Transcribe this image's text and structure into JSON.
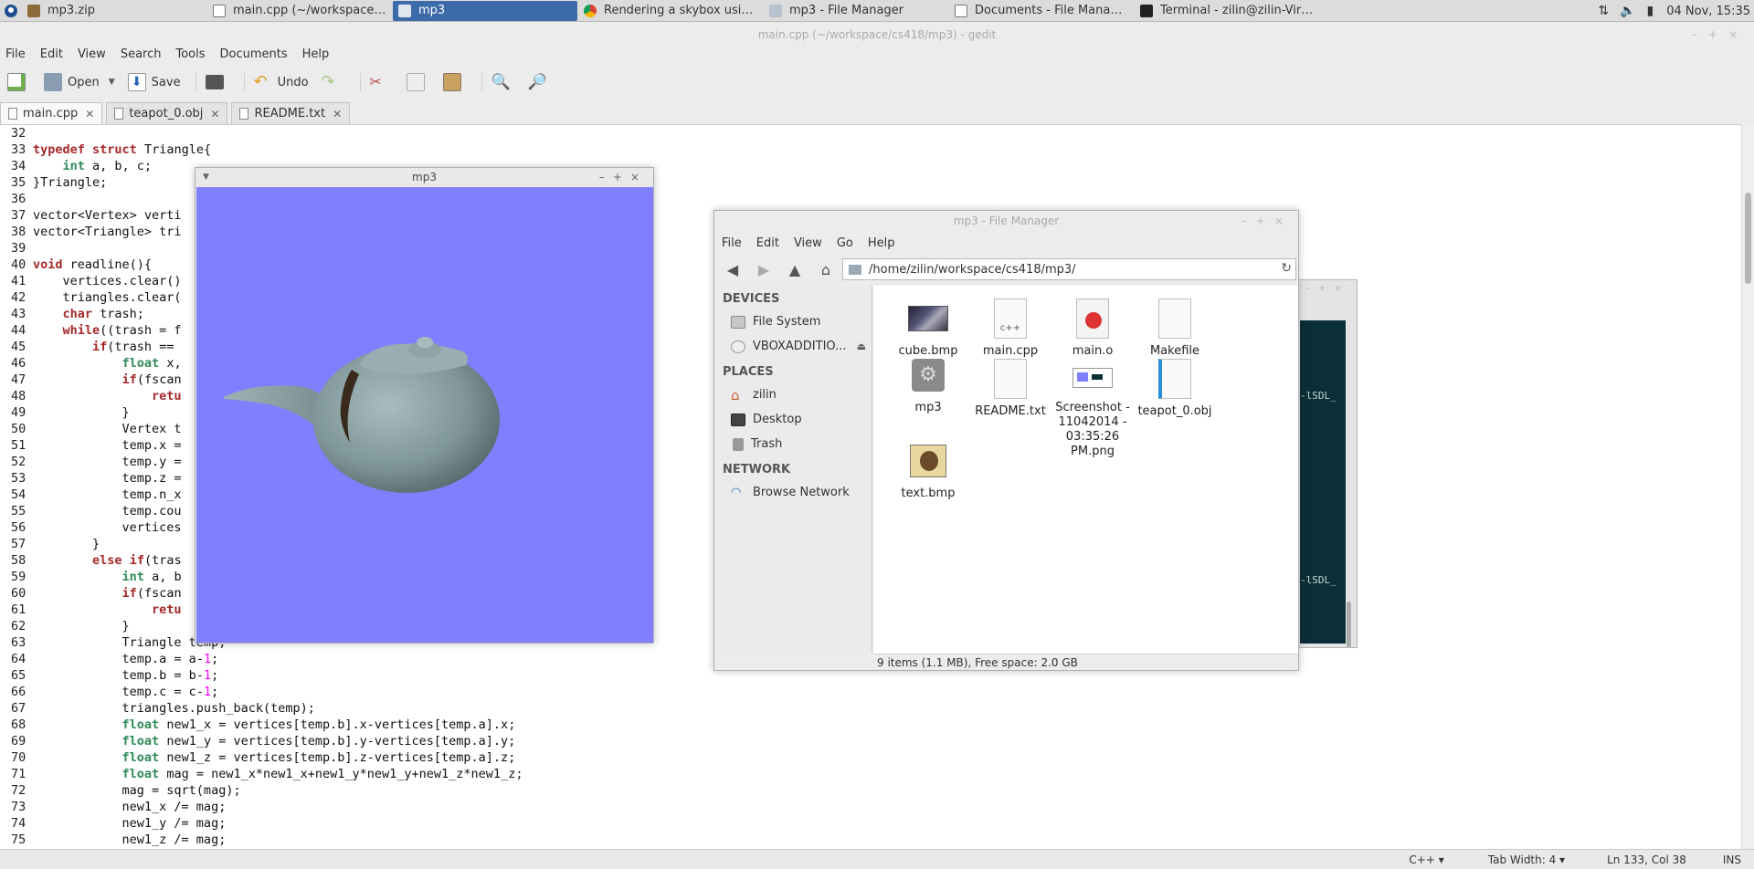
{
  "taskbar": {
    "tasks": [
      {
        "label": "mp3.zip"
      },
      {
        "label": "main.cpp (~/workspace/cs..."
      },
      {
        "label": "mp3"
      },
      {
        "label": "Rendering a skybox using ..."
      },
      {
        "label": "mp3 - File Manager"
      },
      {
        "label": "Documents - File Manager"
      },
      {
        "label": "Terminal - zilin@zilin-Virtua..."
      }
    ],
    "clock": "04 Nov, 15:35"
  },
  "gedit": {
    "title": "main.cpp (~/workspace/cs418/mp3) - gedit",
    "menu": [
      "File",
      "Edit",
      "View",
      "Search",
      "Tools",
      "Documents",
      "Help"
    ],
    "toolbar": {
      "open": "Open",
      "save": "Save",
      "undo": "Undo"
    },
    "tabs": [
      {
        "label": "main.cpp"
      },
      {
        "label": "teapot_0.obj"
      },
      {
        "label": "README.txt"
      }
    ],
    "status": {
      "lang": "C++",
      "tab_width": "Tab Width: 4",
      "position": "Ln 133, Col 38",
      "mode": "INS"
    }
  },
  "code_lines": [
    {
      "n": "32",
      "t": ""
    },
    {
      "n": "33",
      "t": "typedef struct Triangle{"
    },
    {
      "n": "34",
      "t": "    int a, b, c;"
    },
    {
      "n": "35",
      "t": "}Triangle;"
    },
    {
      "n": "36",
      "t": ""
    },
    {
      "n": "37",
      "t": "vector<Vertex> verti"
    },
    {
      "n": "38",
      "t": "vector<Triangle> tri"
    },
    {
      "n": "39",
      "t": ""
    },
    {
      "n": "40",
      "t": "void readline(){"
    },
    {
      "n": "41",
      "t": "    vertices.clear()"
    },
    {
      "n": "42",
      "t": "    triangles.clear("
    },
    {
      "n": "43",
      "t": "    char trash;"
    },
    {
      "n": "44",
      "t": "    while((trash = f"
    },
    {
      "n": "45",
      "t": "        if(trash =="
    },
    {
      "n": "46",
      "t": "            float x,"
    },
    {
      "n": "47",
      "t": "            if(fscan"
    },
    {
      "n": "48",
      "t": "                retu"
    },
    {
      "n": "49",
      "t": "            }"
    },
    {
      "n": "50",
      "t": "            Vertex t"
    },
    {
      "n": "51",
      "t": "            temp.x ="
    },
    {
      "n": "52",
      "t": "            temp.y ="
    },
    {
      "n": "53",
      "t": "            temp.z ="
    },
    {
      "n": "54",
      "t": "            temp.n_x"
    },
    {
      "n": "55",
      "t": "            temp.cou"
    },
    {
      "n": "56",
      "t": "            vertices"
    },
    {
      "n": "57",
      "t": "        }"
    },
    {
      "n": "58",
      "t": "        else if(tras"
    },
    {
      "n": "59",
      "t": "            int a, b"
    },
    {
      "n": "60",
      "t": "            if(fscan"
    },
    {
      "n": "61",
      "t": "                retu"
    },
    {
      "n": "62",
      "t": "            }"
    },
    {
      "n": "63",
      "t": "            Triangle temp;"
    },
    {
      "n": "64",
      "t": "            temp.a = a-1;"
    },
    {
      "n": "65",
      "t": "            temp.b = b-1;"
    },
    {
      "n": "66",
      "t": "            temp.c = c-1;"
    },
    {
      "n": "67",
      "t": "            triangles.push_back(temp);"
    },
    {
      "n": "68",
      "t": "            float new1_x = vertices[temp.b].x-vertices[temp.a].x;"
    },
    {
      "n": "69",
      "t": "            float new1_y = vertices[temp.b].y-vertices[temp.a].y;"
    },
    {
      "n": "70",
      "t": "            float new1_z = vertices[temp.b].z-vertices[temp.a].z;"
    },
    {
      "n": "71",
      "t": "            float mag = new1_x*new1_x+new1_y*new1_y+new1_z*new1_z;"
    },
    {
      "n": "72",
      "t": "            mag = sqrt(mag);"
    },
    {
      "n": "73",
      "t": "            new1_x /= mag;"
    },
    {
      "n": "74",
      "t": "            new1_y /= mag;"
    },
    {
      "n": "75",
      "t": "            new1_z /= mag;"
    }
  ],
  "mp3_window": {
    "title": "mp3"
  },
  "terminal": {
    "lines": [
      "-lSDL_",
      "-lSDL_"
    ]
  },
  "file_manager": {
    "title": "mp3 - File Manager",
    "menu": [
      "File",
      "Edit",
      "View",
      "Go",
      "Help"
    ],
    "path": "/home/zilin/workspace/cs418/mp3/",
    "sidebar": {
      "devices_header": "DEVICES",
      "devices": [
        {
          "label": "File System"
        },
        {
          "label": "VBOXADDITIO..."
        }
      ],
      "places_header": "PLACES",
      "places": [
        {
          "label": "zilin"
        },
        {
          "label": "Desktop"
        },
        {
          "label": "Trash"
        }
      ],
      "network_header": "NETWORK",
      "network": [
        {
          "label": "Browse Network"
        }
      ]
    },
    "files": [
      {
        "name": "cube.bmp",
        "icon": "image-icon"
      },
      {
        "name": "main.cpp",
        "icon": "cpp-file-icon"
      },
      {
        "name": "main.o",
        "icon": "object-file-icon"
      },
      {
        "name": "Makefile",
        "icon": "text-file-icon"
      },
      {
        "name": "mp3",
        "icon": "executable-icon"
      },
      {
        "name": "README.txt",
        "icon": "text-file-icon"
      },
      {
        "name": "Screenshot - 11042014 - 03:35:26 PM.png",
        "icon": "image-icon"
      },
      {
        "name": "teapot_0.obj",
        "icon": "text-file-icon"
      },
      {
        "name": "text.bmp",
        "icon": "image-icon"
      }
    ],
    "status": "9 items (1.1 MB), Free space: 2.0 GB"
  }
}
